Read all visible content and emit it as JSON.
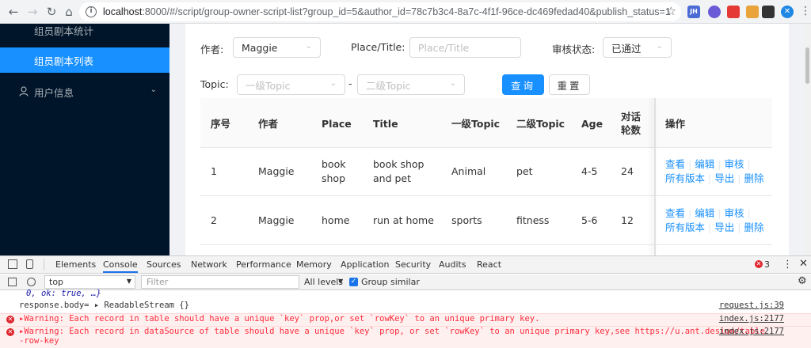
{
  "browser": {
    "url_host": "localhost",
    "url_rest": ":8000/#/script/group-owner-script-list?group_id=5&author_id=78c7b3c4-8a7c-4f1f-96ce-dc469fedad40&publish_status=1",
    "ext_label_jh": "JH"
  },
  "sidebar": {
    "items": [
      {
        "label": "组员剧本统计"
      },
      {
        "label": "组员剧本列表"
      },
      {
        "label": "用户信息"
      }
    ]
  },
  "filters": {
    "author_label": "作者:",
    "author_value": "Maggie",
    "place_label": "Place/Title:",
    "place_placeholder": "Place/Title",
    "status_label": "审核状态:",
    "status_value": "已通过",
    "topic_label": "Topic:",
    "topic1_placeholder": "一级Topic",
    "dash": "-",
    "topic2_placeholder": "二级Topic",
    "search_button": "查询",
    "reset_button": "重置"
  },
  "table": {
    "headers": [
      "序号",
      "作者",
      "Place",
      "Title",
      "一级Topic",
      "二级Topic",
      "Age",
      "对话",
      "轮数",
      "操作"
    ],
    "rows": [
      {
        "index": "1",
        "author": "Maggie",
        "place1": "book",
        "place2": "shop",
        "title1": "book shop",
        "title2": "and pet",
        "topic1": "Animal",
        "topic2": "pet",
        "age": "4-5",
        "turns": "24"
      },
      {
        "index": "2",
        "author": "Maggie",
        "place1": "home",
        "place2": "",
        "title1": "run at home",
        "title2": "",
        "topic1": "sports",
        "topic2": "fitness",
        "age": "5-6",
        "turns": "12"
      }
    ],
    "actions": {
      "view": "查看",
      "edit": "编辑",
      "review": "审核",
      "versions": "所有版本",
      "export": "导出",
      "delete": "删除"
    }
  },
  "devtools": {
    "tabs": [
      "Elements",
      "Console",
      "Sources",
      "Network",
      "Performance",
      "Memory",
      "Application",
      "Security",
      "Audits",
      "React"
    ],
    "error_count": "3",
    "context": "top",
    "filter_placeholder": "Filter",
    "levels": "All levels",
    "group_similar": "Group similar",
    "lines": [
      {
        "text": "0, ok: true, …}",
        "src": ""
      },
      {
        "text": "response.body= ▸ ReadableStream {}",
        "src": "request.js:39"
      },
      {
        "text": "▸Warning: Each record in table should have a unique `key` prop,or set `rowKey` to an unique primary key.",
        "src": "index.js:2177"
      },
      {
        "text": "▸Warning: Each record in dataSource of table should have a unique `key` prop, or set `rowKey` to an unique primary key,see https://u.ant.design/table",
        "text2": "-row-key",
        "src": "index.js:2177"
      }
    ]
  },
  "colors": {
    "primary": "#1890ff",
    "sider": "#001529",
    "error": "#fe2c3b"
  }
}
